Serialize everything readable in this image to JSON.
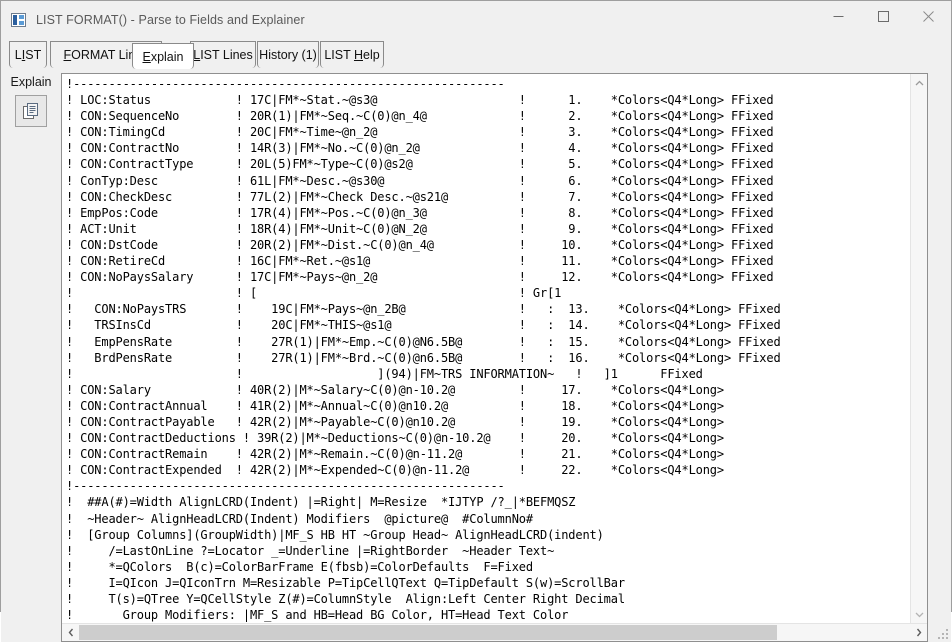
{
  "window": {
    "title": "LIST FORMAT() - Parse to Fields and Explainer",
    "icon": "list-format-icon",
    "controls": [
      {
        "name": "minimize-button",
        "glyph": "minimize-icon"
      },
      {
        "name": "maximize-button",
        "glyph": "maximize-icon"
      },
      {
        "name": "close-button",
        "glyph": "close-icon"
      }
    ]
  },
  "tabs": [
    {
      "label": "LIST",
      "name": "tab-list",
      "active": false
    },
    {
      "label": "FORMAT Lines",
      "name": "tab-format-lines",
      "active": false
    },
    {
      "label": "Explain",
      "name": "tab-explain",
      "active": true
    },
    {
      "label": "LIST Lines",
      "name": "tab-list-lines",
      "active": false
    },
    {
      "label": "History (1)",
      "name": "tab-history",
      "active": false
    },
    {
      "label": "LIST Help",
      "name": "tab-list-help",
      "active": false
    }
  ],
  "left_rail": {
    "label": "Explain",
    "copy_button_name": "copy-button",
    "copy_icon": "copy-pages-icon"
  },
  "scrollbars": {
    "vertical": {
      "up_icon": "chevron-up-icon",
      "down_icon": "chevron-down-icon"
    },
    "horizontal": {
      "left_icon": "chevron-left-icon",
      "right_icon": "chevron-right-icon",
      "thumb_percent": 84
    }
  },
  "colors": {
    "window_bg": "#f0f0f0",
    "pane_bg": "#ffffff",
    "text": "#000000",
    "title_text": "#5a5a5a",
    "border": "#8f8f8f",
    "scroll_thumb": "#cdcdcd"
  },
  "explain_text": "!-------------------------------------------------------------\n! LOC:Status            ! 17C|FM*~Stat.~@s3@                    !      1.    *Colors<Q4*Long> FFixed\n! CON:SequenceNo        ! 20R(1)|FM*~Seq.~C(0)@n_4@             !      2.    *Colors<Q4*Long> FFixed\n! CON:TimingCd          ! 20C|FM*~Time~@n_2@                    !      3.    *Colors<Q4*Long> FFixed\n! CON:ContractNo        ! 14R(3)|FM*~No.~C(0)@n_2@              !      4.    *Colors<Q4*Long> FFixed\n! CON:ContractType      ! 20L(5)FM*~Type~C(0)@s2@               !      5.    *Colors<Q4*Long> FFixed\n! ConTyp:Desc           ! 61L|FM*~Desc.~@s30@                   !      6.    *Colors<Q4*Long> FFixed\n! CON:CheckDesc         ! 77L(2)|FM*~Check Desc.~@s21@          !      7.    *Colors<Q4*Long> FFixed\n! EmpPos:Code           ! 17R(4)|FM*~Pos.~C(0)@n_3@             !      8.    *Colors<Q4*Long> FFixed\n! ACT:Unit              ! 18R(4)|FM*~Unit~C(0)@N_2@             !      9.    *Colors<Q4*Long> FFixed\n! CON:DstCode           ! 20R(2)|FM*~Dist.~C(0)@n_4@            !     10.    *Colors<Q4*Long> FFixed\n! CON:RetireCd          ! 16C|FM*~Ret.~@s1@                     !     11.    *Colors<Q4*Long> FFixed\n! CON:NoPaysSalary      ! 17C|FM*~Pays~@n_2@                    !     12.    *Colors<Q4*Long> FFixed\n!                       ! [                                     ! Gr[1\n!   CON:NoPaysTRS       !    19C|FM*~Pays~@n_2B@                !   :  13.    *Colors<Q4*Long> FFixed\n!   TRSInsCd            !    20C|FM*~THIS~@s1@                  !   :  14.    *Colors<Q4*Long> FFixed\n!   EmpPensRate         !    27R(1)|FM*~Emp.~C(0)@N6.5B@        !   :  15.    *Colors<Q4*Long> FFixed\n!   BrdPensRate         !    27R(1)|FM*~Brd.~C(0)@n6.5B@        !   :  16.    *Colors<Q4*Long> FFixed\n!                       !                   ](94)|FM~TRS INFORMATION~   !   ]1      FFixed\n! CON:Salary            ! 40R(2)|M*~Salary~C(0)@n-10.2@         !     17.    *Colors<Q4*Long>\n! CON:ContractAnnual    ! 41R(2)|M*~Annual~C(0)@n10.2@          !     18.    *Colors<Q4*Long>\n! CON:ContractPayable   ! 42R(2)|M*~Payable~C(0)@n10.2@         !     19.    *Colors<Q4*Long>\n! CON:ContractDeductions ! 39R(2)|M*~Deductions~C(0)@n-10.2@    !     20.    *Colors<Q4*Long>\n! CON:ContractRemain    ! 42R(2)|M*~Remain.~C(0)@n-11.2@        !     21.    *Colors<Q4*Long>\n! CON:ContractExpended  ! 42R(2)|M*~Expended~C(0)@n-11.2@       !     22.    *Colors<Q4*Long>\n!-------------------------------------------------------------\n!  ##A(#)=Width AlignLCRD(Indent) |=Right| M=Resize  *IJTYP /?_|*BEFMQSZ\n!  ~Header~ AlignHeadLCRD(Indent) Modifiers  @picture@  #ColumnNo#\n!  [Group Columns](GroupWidth)|MF_S HB HT ~Group Head~ AlignHeadLCRD(indent)\n!     /=LastOnLine ?=Locator _=Underline |=RightBorder  ~Header Text~\n!     *=QColors  B(c)=ColorBarFrame E(fbsb)=ColorDefaults  F=Fixed\n!     I=QIcon J=QIconTrn M=Resizable P=TipCellQText Q=TipDefault S(w)=ScrollBar\n!     T(s)=QTree Y=QCellStyle Z(#)=ColumnStyle  Align:Left Center Right Decimal\n!       Group Modifiers: |MF_S and HB=Head BG Color, HT=Head Text Color"
}
